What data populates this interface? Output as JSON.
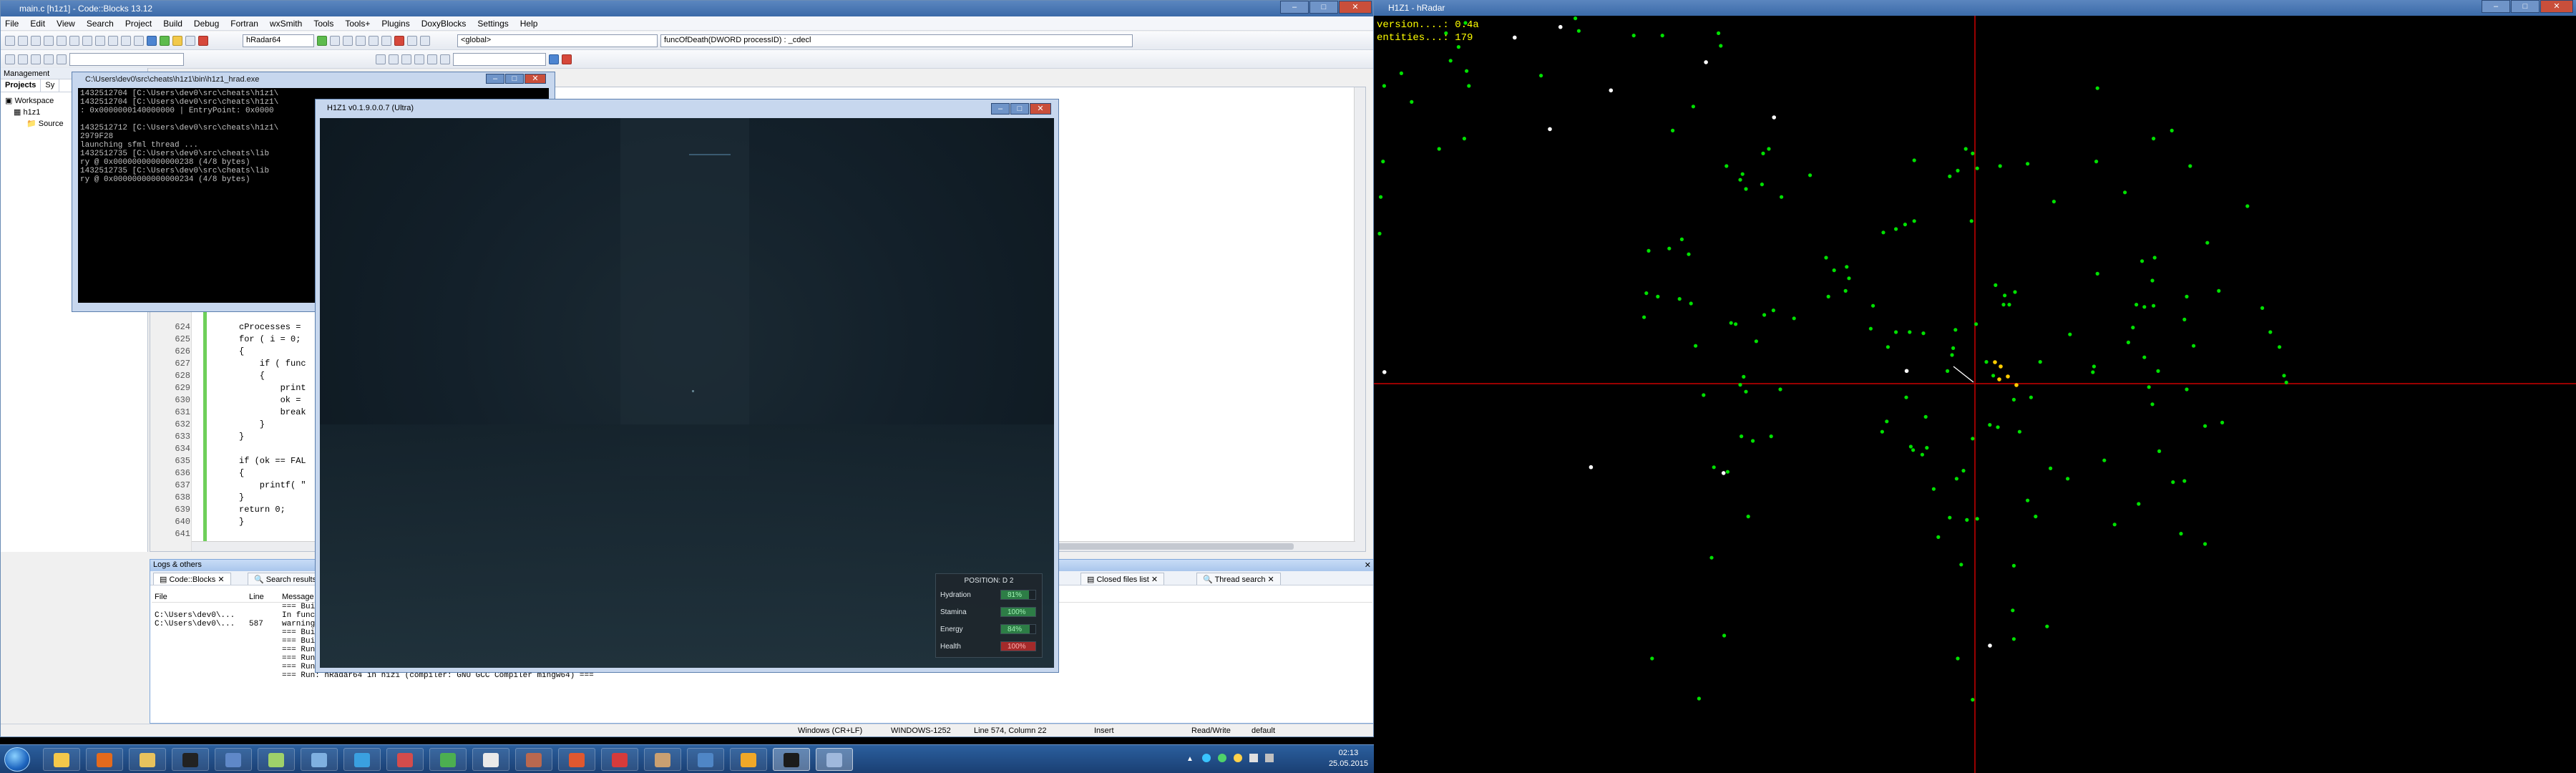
{
  "codeblocks": {
    "title": "main.c [h1z1] - Code::Blocks 13.12",
    "menu": [
      "File",
      "Edit",
      "View",
      "Search",
      "Project",
      "Build",
      "Debug",
      "Fortran",
      "wxSmith",
      "Tools",
      "Tools+",
      "Plugins",
      "DoxyBlocks",
      "Settings",
      "Help"
    ],
    "build_target": "hRadar64",
    "scope_select": "<global>",
    "function_select": "funcOfDeath(DWORD processID) : _cdecl",
    "management": {
      "header": "Management",
      "tabs": [
        "Projects",
        "Sy"
      ],
      "tree": [
        "Workspace",
        "h1z1",
        "Source"
      ]
    },
    "code_lines": [
      {
        "n": "624",
        "t": "cProcesses ="
      },
      {
        "n": "625",
        "t": "for ( i = 0;"
      },
      {
        "n": "626",
        "t": "{"
      },
      {
        "n": "627",
        "t": "    if ( func"
      },
      {
        "n": "628",
        "t": "    {"
      },
      {
        "n": "629",
        "t": "        print"
      },
      {
        "n": "630",
        "t": "        ok ="
      },
      {
        "n": "631",
        "t": "        break"
      },
      {
        "n": "632",
        "t": "    }"
      },
      {
        "n": "633",
        "t": "}"
      },
      {
        "n": "634",
        "t": ""
      },
      {
        "n": "635",
        "t": "if (ok == FAL"
      },
      {
        "n": "636",
        "t": "{"
      },
      {
        "n": "637",
        "t": "    printf( \""
      },
      {
        "n": "638",
        "t": "}"
      },
      {
        "n": "639",
        "t": "return 0;"
      },
      {
        "n": "640",
        "t": "}"
      },
      {
        "n": "641",
        "t": ""
      }
    ],
    "logs": {
      "header": "Logs & others",
      "tabs": [
        "Code::Blocks",
        "Search results",
        "Closed files list",
        "Thread search"
      ],
      "columns": [
        "File",
        "Line",
        "Message"
      ],
      "rows": [
        {
          "file": "",
          "line": "",
          "msg": "=== Bui"
        },
        {
          "file": "C:\\Users\\dev0\\...",
          "line": "",
          "msg": "In func"
        },
        {
          "file": "C:\\Users\\dev0\\...",
          "line": "587",
          "msg": "warning"
        },
        {
          "file": "",
          "line": "",
          "msg": "=== Bui"
        },
        {
          "file": "",
          "line": "",
          "msg": "=== Bui"
        },
        {
          "file": "",
          "line": "",
          "msg": "=== Run: hRadar64 in h1z1 (compiler: GNU GCC Compiler mingw64) ==="
        },
        {
          "file": "",
          "line": "",
          "msg": "=== Run: hRadar64 in h1z1 (compiler: GNU GCC Compiler mingw64) ==="
        },
        {
          "file": "",
          "line": "",
          "msg": "=== Run: hRadar64 in h1z1 (compiler: GNU GCC Compiler mingw64) ==="
        },
        {
          "file": "",
          "line": "",
          "msg": "=== Run: hRadar64 in h1z1 (compiler: GNU GCC Compiler mingw64) ==="
        }
      ]
    },
    "status": {
      "eol": "Windows (CR+LF)",
      "encoding": "WINDOWS-1252",
      "position": "Line 574, Column 22",
      "mode": "Insert",
      "access": "Read/Write",
      "lang": "default"
    }
  },
  "console": {
    "title": "C:\\Users\\dev0\\src\\cheats\\h1z1\\bin\\h1z1_hrad.exe",
    "lines": [
      "1432512704 [C:\\Users\\dev0\\src\\cheats\\h1z1\\",
      "1432512704 [C:\\Users\\dev0\\src\\cheats\\h1z1\\",
      ": 0x0000000140000000 | EntryPoint: 0x0000",
      "",
      "1432512712 [C:\\Users\\dev0\\src\\cheats\\h1z1\\",
      "2979F28",
      "launching sfml thread ...",
      "1432512735 [C:\\Users\\dev0\\src\\cheats\\lib",
      "ry @ 0x00000000000000238 (4/8 bytes)",
      "1432512735 [C:\\Users\\dev0\\src\\cheats\\lib",
      "ry @ 0x00000000000000234 (4/8 bytes)"
    ]
  },
  "game": {
    "title": "H1Z1 v0.1.9.0.0.7 (Ultra)",
    "hud": {
      "position": "POSITION: D 2",
      "stats": [
        {
          "label": "Hydration",
          "value": "81%",
          "level": 0.81,
          "color": "#2d7d46"
        },
        {
          "label": "Stamina",
          "value": "100%",
          "level": 1.0,
          "color": "#2d7d46"
        },
        {
          "label": "Energy",
          "value": "84%",
          "level": 0.84,
          "color": "#2d7d46"
        },
        {
          "label": "Health",
          "value": "100%",
          "level": 1.0,
          "color": "#a42a2a"
        }
      ]
    }
  },
  "taskbar": {
    "clock_time": "02:13",
    "clock_date": "25.05.2015",
    "apps": [
      {
        "name": "explorer-icon",
        "color": "#f4c84a"
      },
      {
        "name": "firefox-icon",
        "color": "#e36a1c"
      },
      {
        "name": "folder-icon",
        "color": "#e8c25d"
      },
      {
        "name": "terminal-icon",
        "color": "#222222"
      },
      {
        "name": "tool-icon",
        "color": "#5f88c8"
      },
      {
        "name": "notepad-icon",
        "color": "#9fd16a"
      },
      {
        "name": "app-icon",
        "color": "#7fb0e0"
      },
      {
        "name": "bird-icon",
        "color": "#3aa0e0"
      },
      {
        "name": "grid-icon",
        "color": "#d44c4c"
      },
      {
        "name": "chart-icon",
        "color": "#4caf50"
      },
      {
        "name": "doc-icon",
        "color": "#e9e9e9"
      },
      {
        "name": "avatar-icon",
        "color": "#b9684f"
      },
      {
        "name": "puzzle-icon",
        "color": "#e0582f"
      },
      {
        "name": "gear-icon",
        "color": "#d63b3b"
      },
      {
        "name": "coffee-icon",
        "color": "#caa071"
      },
      {
        "name": "globe-icon",
        "color": "#4f86c6"
      },
      {
        "name": "codeblocks-icon",
        "color": "#f0a828"
      },
      {
        "name": "h1z1-icon",
        "color": "#1b1b1b"
      },
      {
        "name": "window-icon",
        "color": "#9fb8dc"
      }
    ]
  },
  "radar": {
    "title": "H1Z1 - hRadar",
    "version_line": "version....: 0.4a",
    "entities_line": "entities...: 179",
    "colors": {
      "entity": "#00e000",
      "item": "#ffffff",
      "player": "#ffcc00",
      "crosshair": "#cc0000"
    }
  }
}
